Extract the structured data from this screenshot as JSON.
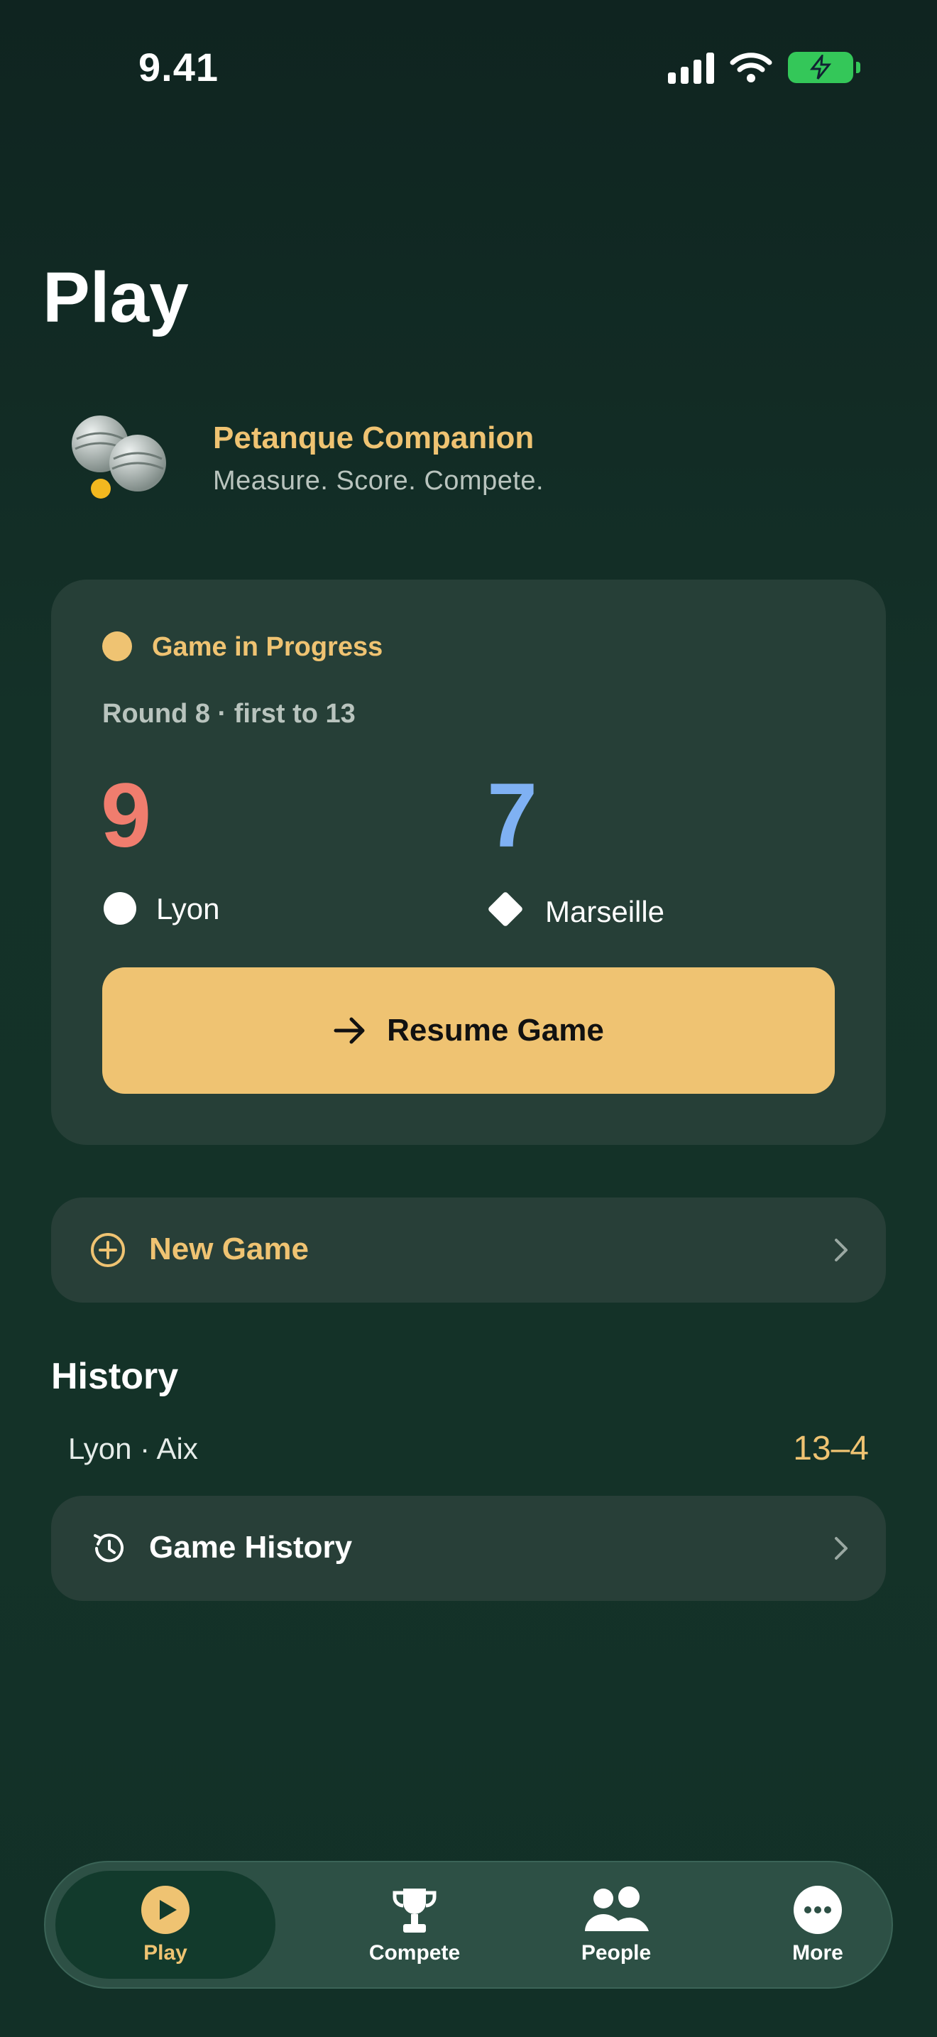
{
  "status_bar": {
    "time": "9.41"
  },
  "page": {
    "title": "Play"
  },
  "brand": {
    "name": "Petanque Companion",
    "tagline": "Measure. Score. Compete."
  },
  "current_game": {
    "status_label": "Game in Progress",
    "round_info": "Round 8 · first to 13",
    "team_a": {
      "name": "Lyon",
      "score": "9",
      "color": "#f07d6e"
    },
    "team_b": {
      "name": "Marseille",
      "score": "7",
      "color": "#7fb1f3"
    },
    "resume_label": "Resume Game"
  },
  "new_game": {
    "label": "New Game"
  },
  "history": {
    "title": "History",
    "recent": {
      "teams": "Lyon · Aix",
      "score": "13–4"
    },
    "link_label": "Game History"
  },
  "tabs": [
    {
      "label": "Play",
      "icon": "play-icon",
      "active": true
    },
    {
      "label": "Compete",
      "icon": "trophy-icon",
      "active": false
    },
    {
      "label": "People",
      "icon": "people-icon",
      "active": false
    },
    {
      "label": "More",
      "icon": "more-icon",
      "active": false
    }
  ],
  "colors": {
    "accent": "#efc372",
    "background": "#143128",
    "card": "#263f37"
  }
}
